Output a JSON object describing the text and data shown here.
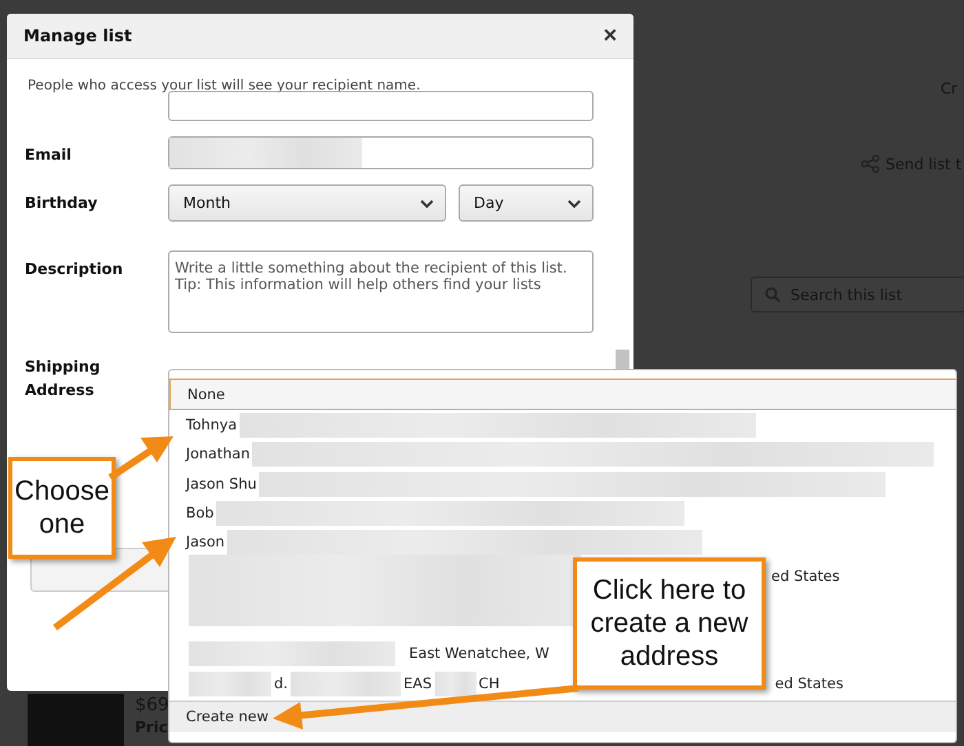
{
  "background_page": {
    "top_link": "Cr",
    "send_link": "Send list t",
    "search": {
      "placeholder": "Search this list"
    },
    "price": "$69",
    "price_label": "Pric"
  },
  "dialog": {
    "title": "Manage list",
    "close": "×",
    "note": "People who access your list will see your recipient name.",
    "email_label": "Email",
    "birthday_label": "Birthday",
    "month": "Month",
    "day": "Day",
    "description_label": "Description",
    "description": {
      "placeholder": "Write a little something about the recipient of this list. Tip: This information will help others find your lists"
    },
    "shipping_label": "Shipping Address"
  },
  "address_options": [
    {
      "selected": true,
      "segments": [
        {
          "kind": "text",
          "text": "None"
        }
      ]
    },
    {
      "selected": false,
      "segments": [
        {
          "kind": "text",
          "text": "Tohnya"
        },
        {
          "kind": "redacted"
        }
      ]
    },
    {
      "selected": false,
      "segments": [
        {
          "kind": "text",
          "text": "Jonathan"
        },
        {
          "kind": "redacted"
        }
      ]
    },
    {
      "selected": false,
      "segments": [
        {
          "kind": "text",
          "text": "Jason Shu"
        },
        {
          "kind": "redacted"
        }
      ]
    },
    {
      "selected": false,
      "segments": [
        {
          "kind": "text",
          "text": "Bob"
        },
        {
          "kind": "redacted"
        }
      ]
    },
    {
      "selected": false,
      "segments": [
        {
          "kind": "text",
          "text": "Jason"
        },
        {
          "kind": "redacted"
        }
      ]
    },
    {
      "selected": false,
      "segments": [
        {
          "kind": "redacted"
        },
        {
          "kind": "text",
          "text": "ed States"
        }
      ]
    },
    {
      "selected": false,
      "segments": [
        {
          "kind": "redacted"
        },
        {
          "kind": "text",
          "text": "East Wenatchee, W"
        }
      ]
    },
    {
      "selected": false,
      "segments": [
        {
          "kind": "redacted"
        },
        {
          "kind": "text",
          "text": "d."
        },
        {
          "kind": "redacted"
        },
        {
          "kind": "text",
          "text": "EAS"
        },
        {
          "kind": "redacted"
        },
        {
          "kind": "text",
          "text": "CH"
        },
        {
          "kind": "text",
          "text": "ed States"
        }
      ]
    }
  ],
  "create_new": "Create new",
  "callouts": [
    {
      "text": "Choose one"
    },
    {
      "text": "Click here to create a new address"
    }
  ]
}
